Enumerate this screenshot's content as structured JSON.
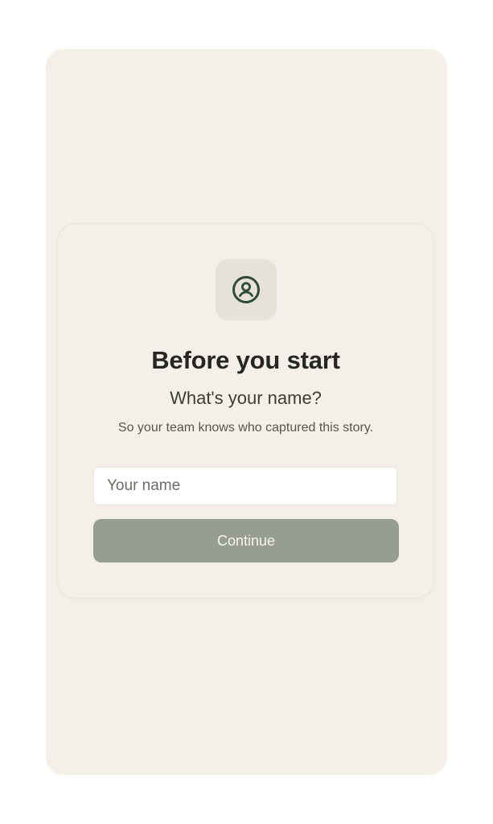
{
  "onboarding": {
    "icon": "user-circle-icon",
    "title": "Before you start",
    "question": "What's your name?",
    "helper_text": "So your team knows who captured this story.",
    "name_input": {
      "value": "",
      "placeholder": "Your name"
    },
    "continue_label": "Continue"
  },
  "colors": {
    "background": "#f4f0e9",
    "icon_tile": "#e6e2da",
    "icon_stroke": "#2f4a3a",
    "button": "#989d94",
    "button_text": "#f4f3ef",
    "title_text": "#262622"
  }
}
